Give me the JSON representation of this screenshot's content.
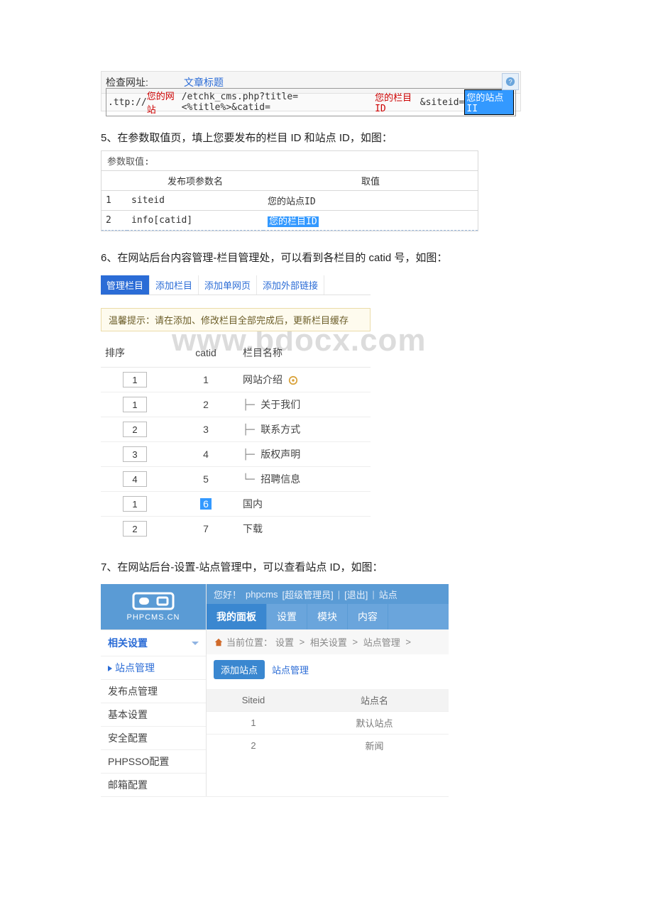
{
  "section1": {
    "label": "检查网址:",
    "link_text": "文章标题",
    "url_prefix": ".ttp://",
    "url_site": "您的网站",
    "url_mid": "/etchk_cms.php?title=<%title%>&catid=",
    "url_catid": "您的栏目ID",
    "url_siteparam": "&siteid=",
    "url_siteid": "您的站点II"
  },
  "step5": "5、在参数取值页，填上您要发布的栏目 ID 和站点 ID，如图：",
  "section2": {
    "title": "参数取值:",
    "headers": {
      "idx": "",
      "name": "发布项参数名",
      "value": "取值"
    },
    "rows": [
      {
        "idx": "1",
        "name": "siteid",
        "value": "您的站点ID",
        "hl": false
      },
      {
        "idx": "2",
        "name": "info[catid]",
        "value": "您的栏目ID",
        "hl": true
      }
    ]
  },
  "step6": "6、在网站后台内容管理-栏目管理处，可以看到各栏目的 catid 号，如图：",
  "section3": {
    "tabs": [
      "管理栏目",
      "添加栏目",
      "添加单网页",
      "添加外部链接"
    ],
    "tip": "温馨提示：请在添加、修改栏目全部完成后，更新栏目缓存",
    "headers": {
      "sort": "排序",
      "catid": "catid",
      "name": "栏目名称"
    },
    "rows": [
      {
        "sort": "1",
        "catid": "1",
        "prefix": "",
        "name": "网站介绍",
        "gear": true
      },
      {
        "sort": "1",
        "catid": "2",
        "prefix": "├─ ",
        "name": "关于我们"
      },
      {
        "sort": "2",
        "catid": "3",
        "prefix": "├─ ",
        "name": "联系方式"
      },
      {
        "sort": "3",
        "catid": "4",
        "prefix": "├─ ",
        "name": "版权声明"
      },
      {
        "sort": "4",
        "catid": "5",
        "prefix": "└─ ",
        "name": "招聘信息"
      },
      {
        "sort": "1",
        "catid": "6",
        "prefix": "",
        "name": "国内",
        "catid_hl": true
      },
      {
        "sort": "2",
        "catid": "7",
        "prefix": "",
        "name": "下载"
      }
    ]
  },
  "watermark": "www.bdocx.com",
  "step7": "7、在网站后台-设置-站点管理中，可以查看站点 ID，如图：",
  "section4": {
    "logo_text": "PHPCMS.CN",
    "left_group_title": "相关设置",
    "left_items": [
      {
        "label": "站点管理",
        "active": true
      },
      {
        "label": "发布点管理"
      },
      {
        "label": "基本设置"
      },
      {
        "label": "安全配置"
      },
      {
        "label": "PHPSSO配置"
      },
      {
        "label": "邮箱配置"
      }
    ],
    "userbar": {
      "greeting": "您好！",
      "user": "phpcms",
      "role": "[超级管理员]",
      "logout": "[退出]",
      "site": "站点"
    },
    "nav": [
      "我的面板",
      "设置",
      "模块",
      "内容"
    ],
    "nav_active": "我的面板",
    "breadcrumb": {
      "label": "当前位置：",
      "parts": [
        "设置",
        "相关设置",
        "站点管理"
      ]
    },
    "actions": {
      "add": "添加站点",
      "manage": "站点管理"
    },
    "site_table": {
      "headers": {
        "id": "Siteid",
        "name": "站点名"
      },
      "rows": [
        {
          "id": "1",
          "name": "默认站点"
        },
        {
          "id": "2",
          "name": "新闻"
        }
      ]
    }
  }
}
